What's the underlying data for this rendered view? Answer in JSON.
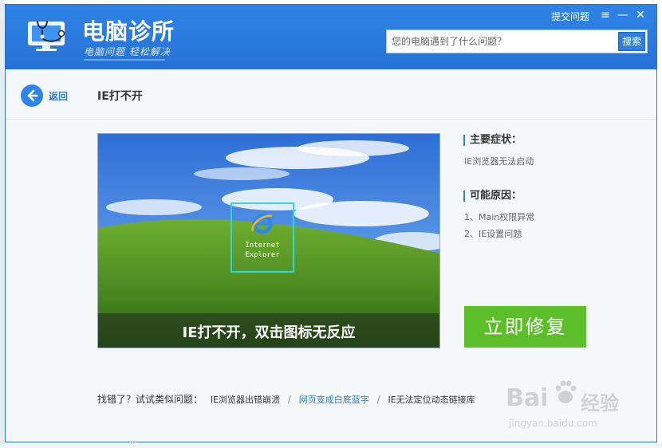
{
  "header": {
    "app_title": "电脑诊所",
    "slogan": "电脑问题 轻松解决",
    "feedback": "提交问题",
    "menu_icon": "≡",
    "minimize_icon": "—",
    "close_icon": "✕"
  },
  "search": {
    "placeholder": "您的电脑遇到了什么问题？",
    "button": "搜索"
  },
  "nav": {
    "back_label": "返回"
  },
  "page": {
    "title": "IE打不开"
  },
  "preview": {
    "icon_label": "Internet\nExplorer",
    "caption": "IE打不开，双击图标无反应"
  },
  "info": {
    "symptom_title": "主要症状：",
    "symptom_text": "IE浏览器无法启动",
    "cause_title": "可能原因：",
    "causes": [
      "1、Main权限异常",
      "2、IE设置问题"
    ]
  },
  "actions": {
    "fix_button": "立即修复"
  },
  "similar": {
    "label": "找错了？试试类似问题：",
    "questions": [
      "IE浏览器出错崩溃",
      "网页变成白底蓝字",
      "IE无法定位动态链接库"
    ],
    "separator": "/"
  },
  "watermark": {
    "brand": "Bai",
    "brand_cn": "经验",
    "domain": "jingyan.baidu.com"
  },
  "colors": {
    "header_blue": "#2a79dc",
    "fix_green": "#5cbf2a",
    "link_blue": "#2b7bd6",
    "frame_cyan": "#2bd9e6"
  }
}
